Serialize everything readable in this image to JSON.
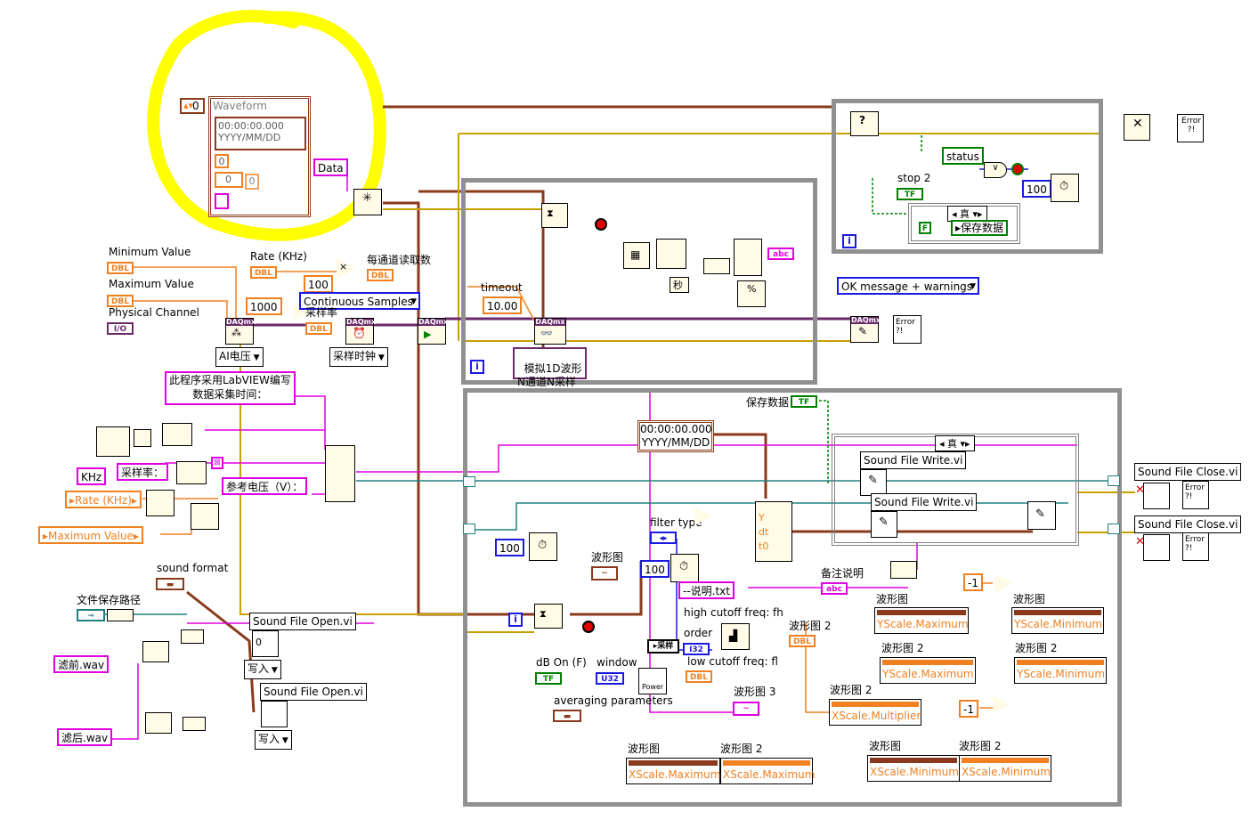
{
  "waveform_cluster": {
    "index": "0",
    "label": "Waveform",
    "t0_time": "00:00:00.000",
    "t0_date": "YYYY/MM/DD",
    "dt": "0",
    "y_index": "0",
    "y_value": "0",
    "data_label": "Data"
  },
  "inputs": {
    "min_value": "Minimum Value",
    "max_value": "Maximum Value",
    "physical_channel": "Physical Channel",
    "rate_khz": "Rate (KHz)",
    "per_channel_read": "每通道读取数",
    "const_100": "100",
    "const_1000": "1000",
    "sample_mode": "Continuous Samples",
    "sample_rate": "采样率",
    "ai_voltage": "AI电压",
    "sample_clock": "采样时钟",
    "dbl": "DBL",
    "io": "I/O"
  },
  "read_loop": {
    "timeout_label": "timeout",
    "timeout_value": "10.00",
    "read_mode": "模拟1D波形\nN通道N采样",
    "sec_label": "秒",
    "percent_label": "%",
    "abc": "abc",
    "i": "i"
  },
  "error_loop": {
    "status": "status",
    "stop": "stop 2",
    "wait": "100",
    "case_true": "真",
    "save_data": "保存数据",
    "tf": "TF",
    "f": "F",
    "i": "i"
  },
  "error_handler": {
    "message_mode": "OK message + warnings",
    "error_text": "Error ?!"
  },
  "notes": {
    "description": "此程序采用LabVIEW编写\n数据采集时间：",
    "khz": "KHz",
    "sample_rate_label": "采样率：",
    "ref_voltage": "参考电压（V）：",
    "rate_khz_ref": "Rate (KHz)",
    "max_value_ref": "Maximum Value"
  },
  "sound_open": {
    "format": "sound format",
    "path_label": "文件保存路径",
    "before": "滤前.wav",
    "after": "滤后.wav",
    "open_vi": "Sound File Open.vi",
    "write_mode": "写入",
    "zero": "0"
  },
  "process_loop": {
    "save_data": "保存数据",
    "timestamp_time": "00:00:00.000",
    "timestamp_date": "YYYY/MM/DD",
    "case_true": "真",
    "write_vi": "Sound File Write.vi",
    "close_vi": "Sound File Close.vi",
    "wait": "100",
    "waveform_graph": "波形图",
    "waveform_graph2": "波形图 2",
    "waveform_graph3": "波形图 3",
    "filter_type": "filter type",
    "order": "order",
    "high_cutoff": "high cutoff freq: fh",
    "low_cutoff": "low cutoff freq: fl",
    "notes_remark": "备注说明",
    "readme": "--说明.txt",
    "db_on": "dB On (F)",
    "window": "window",
    "averaging": "averaging parameters",
    "power": "Power",
    "y": "Y",
    "dt": "dt",
    "t0": "t0",
    "sample": "采样",
    "i": "i",
    "neg1": "-1",
    "yscale_max": "YScale.Maximum",
    "yscale_min": "YScale.Minimum",
    "xscale_mult": "XScale.Multiplier",
    "xscale_max": "XScale.Maximum",
    "xscale_min": "XScale.Minimum",
    "u32": "U32",
    "i32": "I32"
  },
  "colors": {
    "waveform_wire": "#8a3a1a",
    "error_wire": "#c8a000",
    "daq_wire": "#6a2a6a",
    "string_wire": "#e000e0",
    "numeric_wire": "#f08020",
    "bool_wire": "#008000",
    "highlight": "#ffff00",
    "structure": "#909090"
  }
}
